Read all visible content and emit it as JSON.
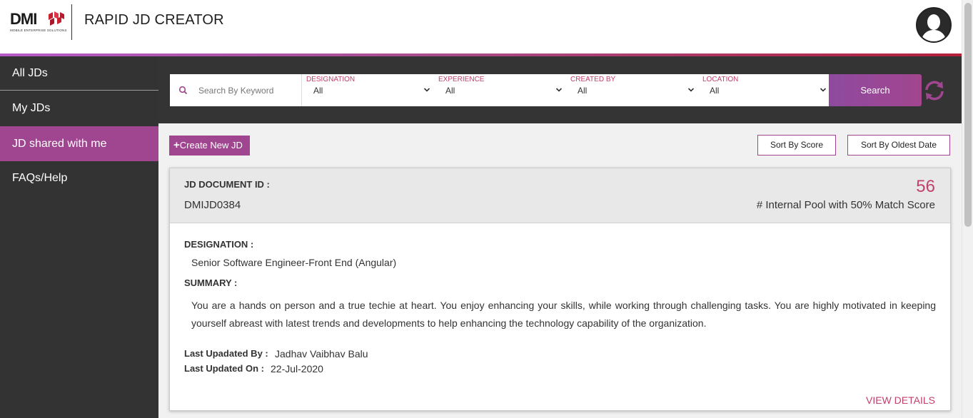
{
  "header": {
    "logo_text": "DMI",
    "logo_tagline": "MOBILE ENTERPRISE SOLUTIONS",
    "app_title": "RAPID JD CREATOR"
  },
  "sidebar": {
    "items": [
      {
        "label": "All JDs"
      },
      {
        "label": "My JDs"
      },
      {
        "label": "JD shared with me"
      },
      {
        "label": "FAQs/Help"
      }
    ]
  },
  "search": {
    "keyword_placeholder": "Search By Keyword",
    "filters": [
      {
        "label": "DESIGNATION",
        "value": "All"
      },
      {
        "label": "EXPERIENCE",
        "value": "All"
      },
      {
        "label": "CREATED BY",
        "value": "All"
      },
      {
        "label": "LOCATION",
        "value": "All"
      }
    ],
    "button_label": "Search"
  },
  "actions": {
    "create_label": "Create New JD",
    "create_icon": "+",
    "sort_score_label": "Sort By Score",
    "sort_date_label": "Sort By Oldest Date"
  },
  "card": {
    "doc_id_label": "JD DOCUMENT ID :",
    "doc_id": "DMIJD0384",
    "score": "56",
    "score_caption": "# Internal Pool with 50% Match Score",
    "designation_label": "DESIGNATION :",
    "designation": "Senior Software Engineer-Front End (Angular)",
    "summary_label": "SUMMARY :",
    "summary": "You are a hands on person and a true techie at heart. You enjoy enhancing your skills, while working through challenging tasks. You are highly motivated in keeping yourself abreast with latest trends and developments to help enhancing the technology capability of the organization.",
    "updated_by_label": "Last Upadated By :",
    "updated_by": "Jadhav Vaibhav Balu",
    "updated_on_label": "Last Updated On :",
    "updated_on": "22-Jul-2020",
    "view_details": "VIEW DETAILS"
  },
  "colors": {
    "accent": "#a0458f",
    "highlight": "#c0416b",
    "sidebar_bg": "#333333"
  }
}
